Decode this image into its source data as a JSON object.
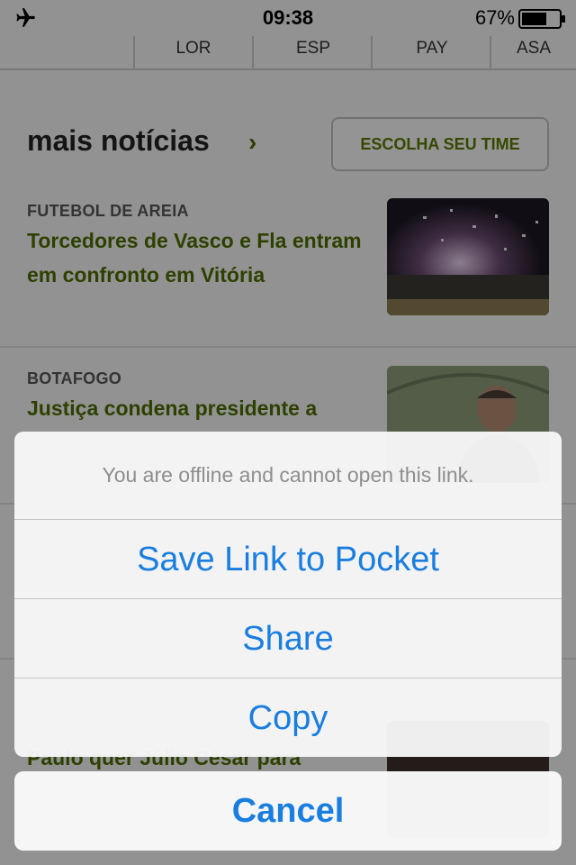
{
  "status_bar": {
    "time": "09:38",
    "battery_percent": "67%",
    "battery_level": 0.67,
    "airplane_icon": "airplane-icon"
  },
  "score_tabs": [
    "LOR",
    "ESP",
    "PAY",
    "ASA"
  ],
  "section": {
    "title": "mais notícias",
    "chevron": "›",
    "choose_team_label": "ESCOLHA SEU TIME"
  },
  "news": [
    {
      "category": "FUTEBOL DE AREIA",
      "headline": "Torcedores de Vasco e Fla entram em confronto em Vitória"
    },
    {
      "category": "BOTAFOGO",
      "headline": "Justiça condena presidente a"
    },
    {
      "category": "",
      "headline": "Paulo quer Júlio César para"
    }
  ],
  "action_sheet": {
    "message": "You are offline and cannot open this link.",
    "save_label": "Save Link to Pocket",
    "share_label": "Share",
    "copy_label": "Copy",
    "cancel_label": "Cancel"
  },
  "colors": {
    "ios_blue": "#1a7ee0",
    "headline_green": "#4d6c00"
  }
}
